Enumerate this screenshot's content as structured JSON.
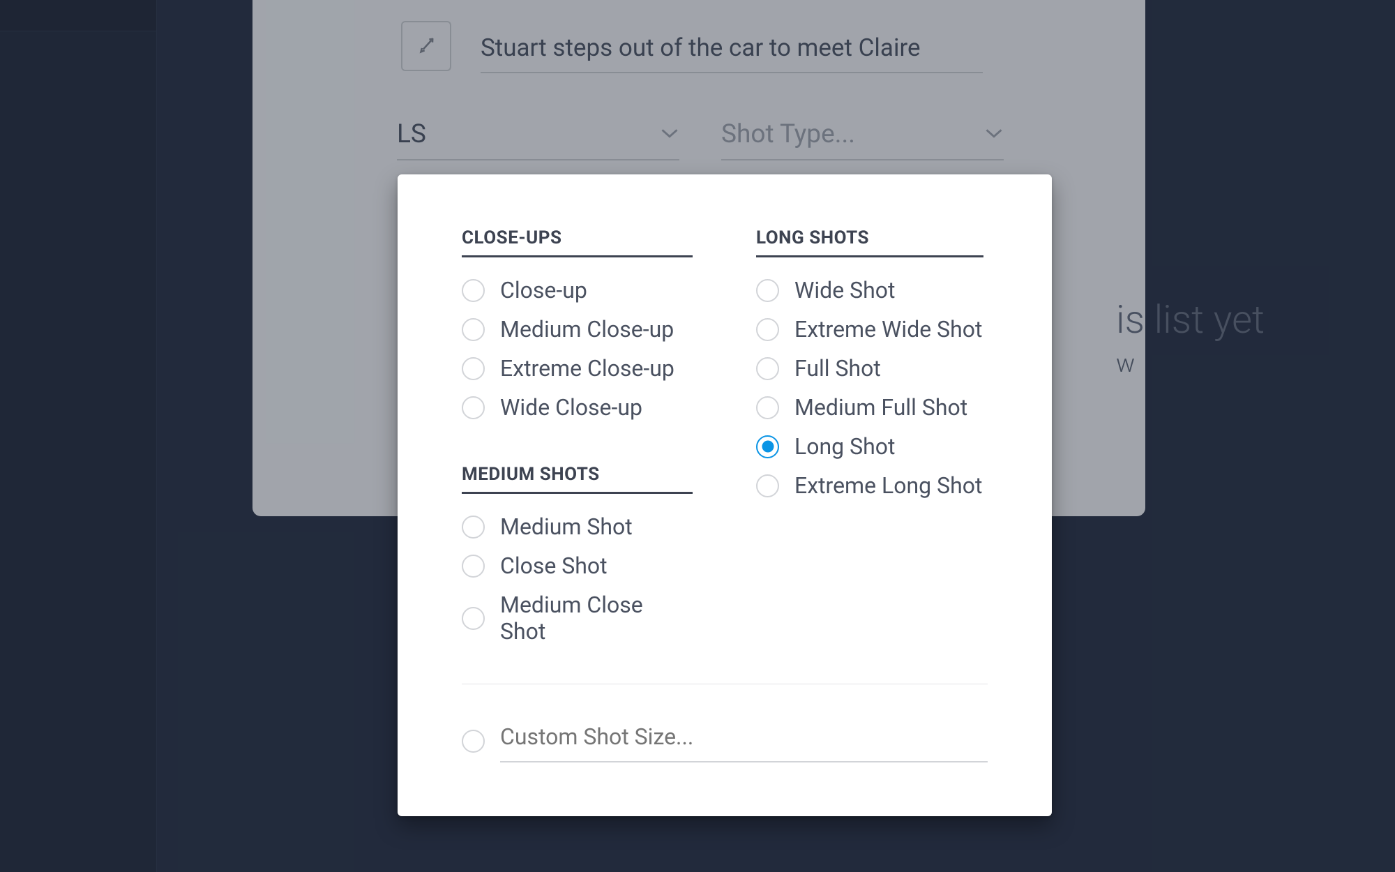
{
  "bg_card": {
    "desc": "Stuart steps out of the car to meet Claire",
    "shot_size_value": "LS",
    "shot_type_placeholder": "Shot Type..."
  },
  "hint": {
    "title_tail": "is list yet",
    "sub_tail": "w"
  },
  "popover": {
    "groups": {
      "closeups": {
        "header": "CLOSE-UPS",
        "options": [
          "Close-up",
          "Medium Close-up",
          "Extreme Close-up",
          "Wide Close-up"
        ]
      },
      "medium": {
        "header": "MEDIUM SHOTS",
        "options": [
          "Medium Shot",
          "Close Shot",
          "Medium Close Shot"
        ]
      },
      "long": {
        "header": "LONG SHOTS",
        "options": [
          "Wide Shot",
          "Extreme Wide Shot",
          "Full Shot",
          "Medium Full Shot",
          "Long Shot",
          "Extreme Long Shot"
        ]
      }
    },
    "selected": "Long Shot",
    "custom_placeholder": "Custom Shot Size..."
  }
}
